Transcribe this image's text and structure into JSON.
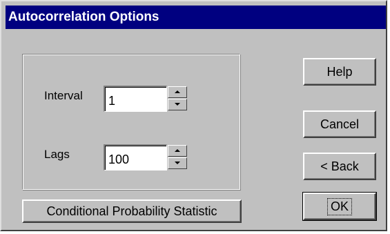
{
  "window": {
    "title": "Autocorrelation Options"
  },
  "fields": {
    "interval_label": "Interval",
    "interval_value": "1",
    "lags_label": "Lags",
    "lags_value": "100"
  },
  "buttons": {
    "help": "Help",
    "cancel": "Cancel",
    "back": "< Back",
    "ok": "OK",
    "conditional_probability": "Conditional Probability Statistic"
  },
  "icons": {
    "spin_up": "triangle-up-icon",
    "spin_down": "triangle-down-icon"
  },
  "colors": {
    "titlebar": "#000080",
    "face": "#c0c0c0"
  }
}
